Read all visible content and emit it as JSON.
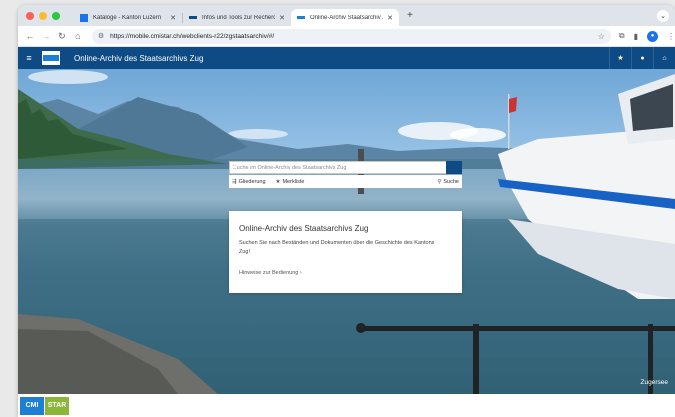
{
  "browser": {
    "tabs": [
      {
        "title": "Kataloge - Kanton Luzern",
        "favicon_color": "#1a73e8",
        "active": false
      },
      {
        "title": "Infos und Tools zur Recherche",
        "favicon_color": "#0e4a83",
        "active": false
      },
      {
        "title": "Online-Archiv Staatsarchiv Zug",
        "favicon_color": "#1d7fd3",
        "active": true
      }
    ],
    "url": "https://mobile.cmistar.ch/webclients-r22/zgstaatsarchiv/#/"
  },
  "app": {
    "title": "Online-Archiv des Staatsarchivs Zug",
    "header_color": "#0e4a83"
  },
  "search": {
    "placeholder": "Suche im Online-Archiv des Staatsarchivs Zug",
    "links": {
      "gliederung": "Gliederung",
      "merkliste": "Merkliste",
      "suche": "Suche"
    }
  },
  "info": {
    "title": "Online-Archiv des Staatsarchivs Zug",
    "text": "Suchen Sie nach Beständen und Dokumenten über die Geschichte des Kantons Zug!",
    "link": "Hinweise zur Bedienung ›"
  },
  "hero": {
    "location": "Zugersee"
  },
  "footer": {
    "logo_left": "CMI",
    "logo_right": "STAR"
  }
}
